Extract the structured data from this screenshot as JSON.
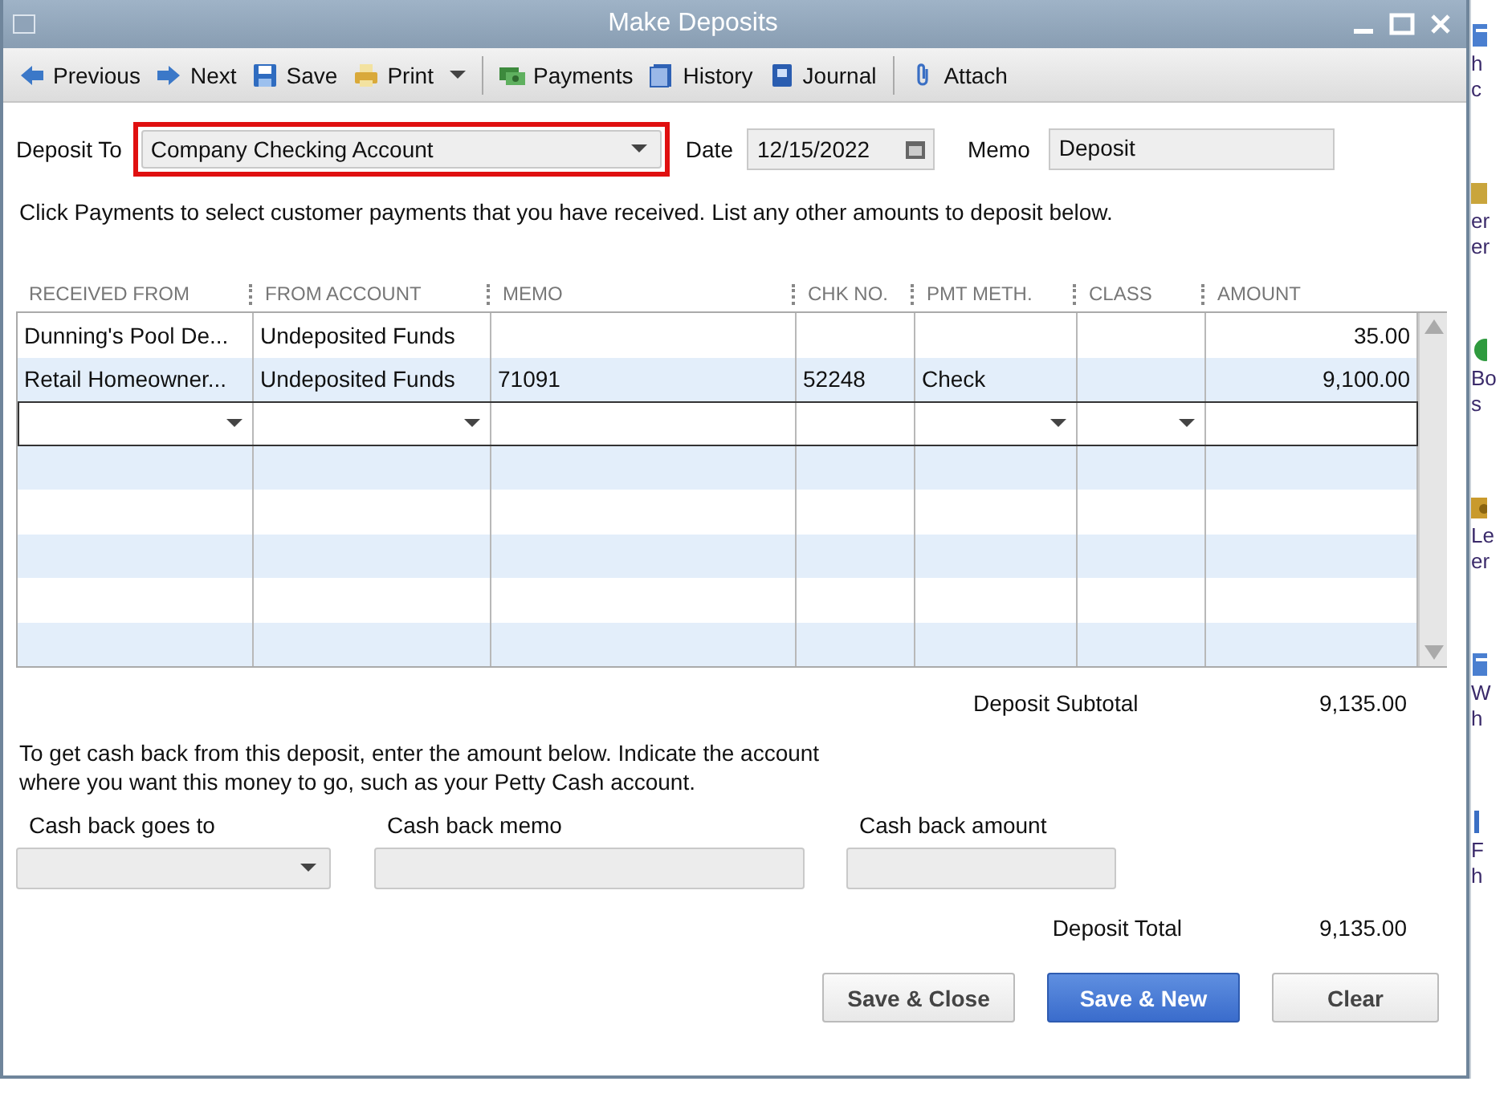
{
  "window": {
    "title": "Make Deposits"
  },
  "toolbar": [
    {
      "label": "Previous",
      "menu": false,
      "sep": false
    },
    {
      "label": "Next",
      "menu": false,
      "sep": false
    },
    {
      "label": "Save",
      "menu": false,
      "sep": false
    },
    {
      "label": "Print",
      "menu": true,
      "sep": false
    },
    {
      "label": "Payments",
      "menu": false,
      "sep": true
    },
    {
      "label": "History",
      "menu": false,
      "sep": false
    },
    {
      "label": "Journal",
      "menu": false,
      "sep": false
    },
    {
      "label": "Attach",
      "menu": false,
      "sep": true
    }
  ],
  "header": {
    "deposit_to_label": "Deposit To",
    "deposit_to": "Company Checking Account",
    "date_label": "Date",
    "date": "12/15/2022",
    "memo_label": "Memo",
    "memo": "Deposit"
  },
  "instructions": "Click Payments to select customer payments that you have received. List any other amounts to deposit below.",
  "table": {
    "columns": [
      {
        "label": "RECEIVED FROM",
        "dropdown": true
      },
      {
        "label": "FROM ACCOUNT",
        "dropdown": true
      },
      {
        "label": "MEMO",
        "dropdown": false
      },
      {
        "label": "CHK NO.",
        "dropdown": false
      },
      {
        "label": "PMT METH.",
        "dropdown": true
      },
      {
        "label": "CLASS",
        "dropdown": true
      },
      {
        "label": "AMOUNT",
        "dropdown": false
      }
    ],
    "rows": [
      [
        "Dunning's Pool De...",
        "Undeposited Funds",
        "",
        "",
        "",
        "",
        "35.00"
      ],
      [
        "Retail Homeowner...",
        "Undeposited Funds",
        "71091",
        "52248",
        "Check",
        "",
        "9,100.00"
      ]
    ]
  },
  "subtotal": {
    "label": "Deposit Subtotal",
    "value": "9,135.00"
  },
  "cash_back": {
    "note": "To get cash back from this deposit, enter the amount below.  Indicate the account\nwhere you want this money to go, such as your Petty Cash account.",
    "goes_to_label": "Cash back goes to",
    "memo_label": "Cash back memo",
    "amount_label": "Cash back amount"
  },
  "total": {
    "label": "Deposit Total",
    "value": "9,135.00"
  },
  "buttons": [
    {
      "label": "Save & Close",
      "primary": false
    },
    {
      "label": "Save & New",
      "primary": true
    },
    {
      "label": "Clear",
      "primary": false
    }
  ],
  "background_app": [
    {
      "lines": [
        "h",
        "c"
      ]
    },
    {
      "lines": [
        "er",
        "er"
      ]
    },
    {
      "lines": [
        "Bo",
        "s"
      ]
    },
    {
      "lines": [
        "Le",
        "er"
      ]
    },
    {
      "lines": [
        "W",
        "h"
      ]
    },
    {
      "lines": [
        "F",
        "h"
      ]
    }
  ]
}
